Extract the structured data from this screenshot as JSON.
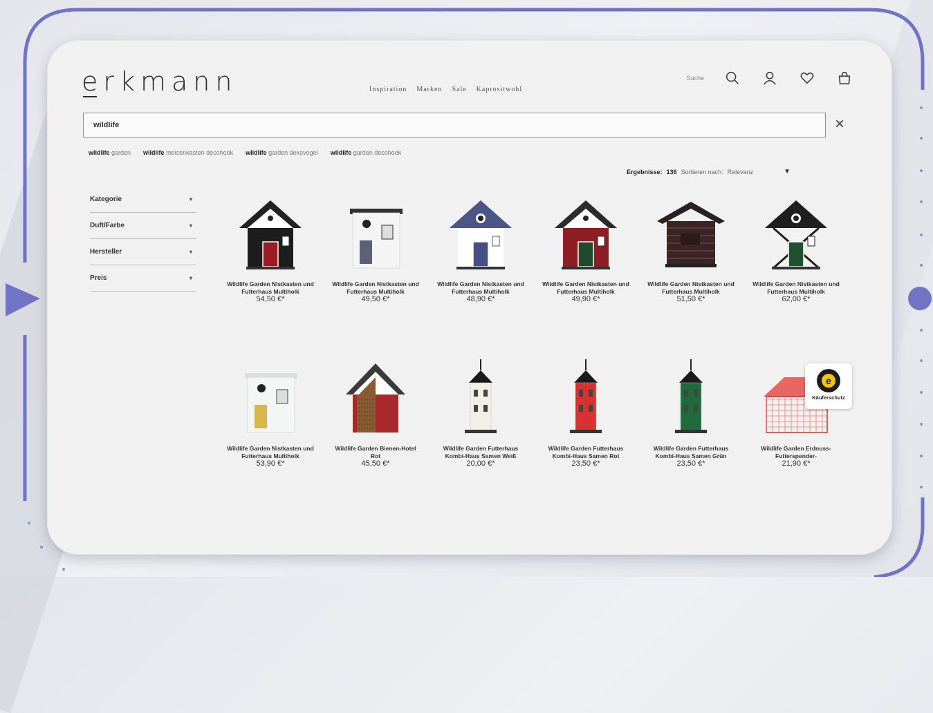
{
  "brand": {
    "logo": "erkmann"
  },
  "nav": [
    "Inspiration",
    "Marken",
    "Sale",
    "Kaprositwohl"
  ],
  "header": {
    "search_label": "Suche"
  },
  "search": {
    "value": "wildlife"
  },
  "suggestions": [
    {
      "bold": "wildlife",
      "rest": " garden"
    },
    {
      "bold": "wildlife",
      "rest": " meisenkasten decohook"
    },
    {
      "bold": "wildlife",
      "rest": " garden dekovogel"
    },
    {
      "bold": "wildlife",
      "rest": " garden decohook"
    }
  ],
  "results": {
    "label": "Ergebnisse:",
    "count": "136",
    "sort_label": "Sortieren nach:",
    "sort_value": "Relevanz"
  },
  "filters": [
    "Kategorie",
    "Duft/Farbe",
    "Hersteller",
    "Preis"
  ],
  "products": [
    {
      "name": "Wildlife Garden Nistkasten und Futterhaus Multiholk",
      "price": "54,50 €*",
      "roof": "#222222",
      "wall": "#1d1d1d",
      "door": "#9c1c22",
      "trim": "#ffffff",
      "kind": "house"
    },
    {
      "name": "Wildlife Garden Nistkasten und Futterhaus Multiholk",
      "price": "49,50 €*",
      "roof": "#333333",
      "wall": "#f4f4f4",
      "door": "#5b6277",
      "trim": "#333333",
      "kind": "modern"
    },
    {
      "name": "Wildlife Garden Nistkasten und Futterhaus Multiholk",
      "price": "48,90 €*",
      "roof": "#4a5686",
      "wall": "#ffffff",
      "door": "#444f85",
      "trim": "#4a5686",
      "kind": "house"
    },
    {
      "name": "Wildlife Garden Nistkasten und Futterhaus Multiholk",
      "price": "49,90 €*",
      "roof": "#2b2b2b",
      "wall": "#8e1d24",
      "door": "#1f4a2c",
      "trim": "#ffffff",
      "kind": "house"
    },
    {
      "name": "Wildlife Garden Nistkasten und Futterhaus Multiholk",
      "price": "51,50 €*",
      "roof": "#2a2020",
      "wall": "#3d2424",
      "door": "#2a1a1a",
      "trim": "#6a4a4a",
      "kind": "chalet"
    },
    {
      "name": "Wildlife Garden Nistkasten und Futterhaus Multiholk",
      "price": "62,00 €*",
      "roof": "#1f1f1f",
      "wall": "#f2f2f2",
      "door": "#1f5030",
      "trim": "#1f1f1f",
      "kind": "tudor"
    },
    {
      "name": "Wildlife Garden Nistkasten und Futterhaus Multiholk",
      "price": "53,90 €*",
      "roof": "#dddddd",
      "wall": "#f4f6f5",
      "door": "#d8b84c",
      "trim": "#1f5a30",
      "kind": "modern"
    },
    {
      "name": "Wildlife Garden Bienen-Hotel Rot",
      "price": "45,50 €*",
      "roof": "#3a3a3a",
      "wall": "#a9282c",
      "door": "#8a5a32",
      "trim": "#ffffff",
      "kind": "bee"
    },
    {
      "name": "Wildlife Garden Futterhaus Kombi-Haus Samen Weiß",
      "price": "20,00 €*",
      "roof": "#1a1a1a",
      "wall": "#f1f0e6",
      "door": "#333333",
      "trim": "#1a1a1a",
      "kind": "tower"
    },
    {
      "name": "Wildlife Garden Futterhaus Kombi-Haus Samen Rot",
      "price": "23,50 €*",
      "roof": "#1a1a1a",
      "wall": "#d6322f",
      "door": "#333333",
      "trim": "#1a1a1a",
      "kind": "tower"
    },
    {
      "name": "Wildlife Garden Futterhaus Kombi-Haus Samen Grün",
      "price": "23,50 €*",
      "roof": "#1a1a1a",
      "wall": "#1f6b3e",
      "door": "#333333",
      "trim": "#1a1a1a",
      "kind": "tower"
    },
    {
      "name": "Wildlife Garden Erdnuss-Futterspender-",
      "price": "21,90 €*",
      "roof": "#e84f4a",
      "wall": "#f07870",
      "door": "#e84f4a",
      "trim": "#c9302b",
      "kind": "mesh"
    }
  ],
  "badge": {
    "label": "Käuferschutz",
    "letter": "e"
  },
  "colors": {
    "frame": "#6f75c4",
    "background": "#eceef2"
  }
}
